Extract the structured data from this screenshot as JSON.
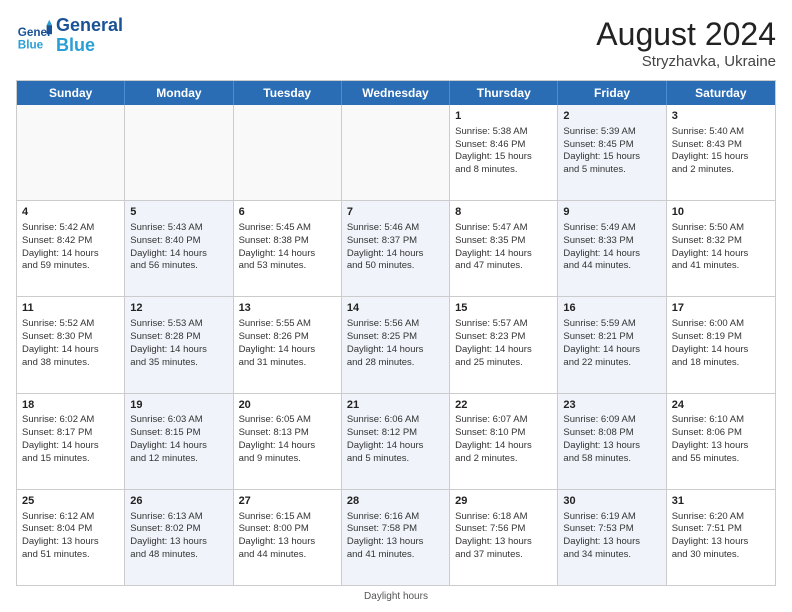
{
  "header": {
    "logo_general": "General",
    "logo_blue": "Blue",
    "month_year": "August 2024",
    "location": "Stryzhavka, Ukraine"
  },
  "days_of_week": [
    "Sunday",
    "Monday",
    "Tuesday",
    "Wednesday",
    "Thursday",
    "Friday",
    "Saturday"
  ],
  "footnote": "Daylight hours",
  "weeks": [
    [
      {
        "day": "",
        "info": "",
        "alt": false,
        "empty": true
      },
      {
        "day": "",
        "info": "",
        "alt": false,
        "empty": true
      },
      {
        "day": "",
        "info": "",
        "alt": false,
        "empty": true
      },
      {
        "day": "",
        "info": "",
        "alt": false,
        "empty": true
      },
      {
        "day": "1",
        "info": "Sunrise: 5:38 AM\nSunset: 8:46 PM\nDaylight: 15 hours\nand 8 minutes.",
        "alt": false,
        "empty": false
      },
      {
        "day": "2",
        "info": "Sunrise: 5:39 AM\nSunset: 8:45 PM\nDaylight: 15 hours\nand 5 minutes.",
        "alt": true,
        "empty": false
      },
      {
        "day": "3",
        "info": "Sunrise: 5:40 AM\nSunset: 8:43 PM\nDaylight: 15 hours\nand 2 minutes.",
        "alt": false,
        "empty": false
      }
    ],
    [
      {
        "day": "4",
        "info": "Sunrise: 5:42 AM\nSunset: 8:42 PM\nDaylight: 14 hours\nand 59 minutes.",
        "alt": false,
        "empty": false
      },
      {
        "day": "5",
        "info": "Sunrise: 5:43 AM\nSunset: 8:40 PM\nDaylight: 14 hours\nand 56 minutes.",
        "alt": true,
        "empty": false
      },
      {
        "day": "6",
        "info": "Sunrise: 5:45 AM\nSunset: 8:38 PM\nDaylight: 14 hours\nand 53 minutes.",
        "alt": false,
        "empty": false
      },
      {
        "day": "7",
        "info": "Sunrise: 5:46 AM\nSunset: 8:37 PM\nDaylight: 14 hours\nand 50 minutes.",
        "alt": true,
        "empty": false
      },
      {
        "day": "8",
        "info": "Sunrise: 5:47 AM\nSunset: 8:35 PM\nDaylight: 14 hours\nand 47 minutes.",
        "alt": false,
        "empty": false
      },
      {
        "day": "9",
        "info": "Sunrise: 5:49 AM\nSunset: 8:33 PM\nDaylight: 14 hours\nand 44 minutes.",
        "alt": true,
        "empty": false
      },
      {
        "day": "10",
        "info": "Sunrise: 5:50 AM\nSunset: 8:32 PM\nDaylight: 14 hours\nand 41 minutes.",
        "alt": false,
        "empty": false
      }
    ],
    [
      {
        "day": "11",
        "info": "Sunrise: 5:52 AM\nSunset: 8:30 PM\nDaylight: 14 hours\nand 38 minutes.",
        "alt": false,
        "empty": false
      },
      {
        "day": "12",
        "info": "Sunrise: 5:53 AM\nSunset: 8:28 PM\nDaylight: 14 hours\nand 35 minutes.",
        "alt": true,
        "empty": false
      },
      {
        "day": "13",
        "info": "Sunrise: 5:55 AM\nSunset: 8:26 PM\nDaylight: 14 hours\nand 31 minutes.",
        "alt": false,
        "empty": false
      },
      {
        "day": "14",
        "info": "Sunrise: 5:56 AM\nSunset: 8:25 PM\nDaylight: 14 hours\nand 28 minutes.",
        "alt": true,
        "empty": false
      },
      {
        "day": "15",
        "info": "Sunrise: 5:57 AM\nSunset: 8:23 PM\nDaylight: 14 hours\nand 25 minutes.",
        "alt": false,
        "empty": false
      },
      {
        "day": "16",
        "info": "Sunrise: 5:59 AM\nSunset: 8:21 PM\nDaylight: 14 hours\nand 22 minutes.",
        "alt": true,
        "empty": false
      },
      {
        "day": "17",
        "info": "Sunrise: 6:00 AM\nSunset: 8:19 PM\nDaylight: 14 hours\nand 18 minutes.",
        "alt": false,
        "empty": false
      }
    ],
    [
      {
        "day": "18",
        "info": "Sunrise: 6:02 AM\nSunset: 8:17 PM\nDaylight: 14 hours\nand 15 minutes.",
        "alt": false,
        "empty": false
      },
      {
        "day": "19",
        "info": "Sunrise: 6:03 AM\nSunset: 8:15 PM\nDaylight: 14 hours\nand 12 minutes.",
        "alt": true,
        "empty": false
      },
      {
        "day": "20",
        "info": "Sunrise: 6:05 AM\nSunset: 8:13 PM\nDaylight: 14 hours\nand 9 minutes.",
        "alt": false,
        "empty": false
      },
      {
        "day": "21",
        "info": "Sunrise: 6:06 AM\nSunset: 8:12 PM\nDaylight: 14 hours\nand 5 minutes.",
        "alt": true,
        "empty": false
      },
      {
        "day": "22",
        "info": "Sunrise: 6:07 AM\nSunset: 8:10 PM\nDaylight: 14 hours\nand 2 minutes.",
        "alt": false,
        "empty": false
      },
      {
        "day": "23",
        "info": "Sunrise: 6:09 AM\nSunset: 8:08 PM\nDaylight: 13 hours\nand 58 minutes.",
        "alt": true,
        "empty": false
      },
      {
        "day": "24",
        "info": "Sunrise: 6:10 AM\nSunset: 8:06 PM\nDaylight: 13 hours\nand 55 minutes.",
        "alt": false,
        "empty": false
      }
    ],
    [
      {
        "day": "25",
        "info": "Sunrise: 6:12 AM\nSunset: 8:04 PM\nDaylight: 13 hours\nand 51 minutes.",
        "alt": false,
        "empty": false
      },
      {
        "day": "26",
        "info": "Sunrise: 6:13 AM\nSunset: 8:02 PM\nDaylight: 13 hours\nand 48 minutes.",
        "alt": true,
        "empty": false
      },
      {
        "day": "27",
        "info": "Sunrise: 6:15 AM\nSunset: 8:00 PM\nDaylight: 13 hours\nand 44 minutes.",
        "alt": false,
        "empty": false
      },
      {
        "day": "28",
        "info": "Sunrise: 6:16 AM\nSunset: 7:58 PM\nDaylight: 13 hours\nand 41 minutes.",
        "alt": true,
        "empty": false
      },
      {
        "day": "29",
        "info": "Sunrise: 6:18 AM\nSunset: 7:56 PM\nDaylight: 13 hours\nand 37 minutes.",
        "alt": false,
        "empty": false
      },
      {
        "day": "30",
        "info": "Sunrise: 6:19 AM\nSunset: 7:53 PM\nDaylight: 13 hours\nand 34 minutes.",
        "alt": true,
        "empty": false
      },
      {
        "day": "31",
        "info": "Sunrise: 6:20 AM\nSunset: 7:51 PM\nDaylight: 13 hours\nand 30 minutes.",
        "alt": false,
        "empty": false
      }
    ]
  ]
}
